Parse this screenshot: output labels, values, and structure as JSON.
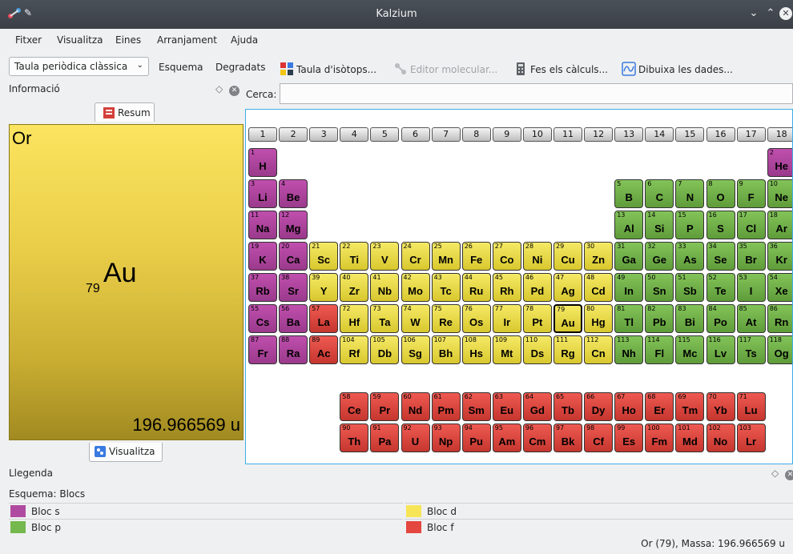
{
  "window": {
    "title": "Kalzium"
  },
  "menu": [
    "Fitxer",
    "Visualitza",
    "Eines",
    "Arranjament",
    "Ajuda"
  ],
  "toolbar": {
    "table_select": "Taula periòdica clàssica",
    "scheme": "Esquema",
    "gradients": "Degradats",
    "isotopes": "Taula d'isòtops...",
    "molecular_editor": "Editor molecular...",
    "calculator": "Fes els càlculs...",
    "plot": "Dibuixa les dades..."
  },
  "info_panel": {
    "title": "Informació",
    "tab_summary": "Resum",
    "tab_view": "Visualitza",
    "element": {
      "name": "Or",
      "symbol": "Au",
      "number": "79",
      "mass": "196.966569 u"
    }
  },
  "search": {
    "label": "Cerca:",
    "value": ""
  },
  "groups": [
    "1",
    "2",
    "3",
    "4",
    "5",
    "6",
    "7",
    "8",
    "9",
    "10",
    "11",
    "12",
    "13",
    "14",
    "15",
    "16",
    "17",
    "18"
  ],
  "elements": [
    {
      "z": "1",
      "s": "H",
      "g": 1,
      "p": 1,
      "b": "s"
    },
    {
      "z": "2",
      "s": "He",
      "g": 18,
      "p": 1,
      "b": "s"
    },
    {
      "z": "3",
      "s": "Li",
      "g": 1,
      "p": 2,
      "b": "s"
    },
    {
      "z": "4",
      "s": "Be",
      "g": 2,
      "p": 2,
      "b": "s"
    },
    {
      "z": "5",
      "s": "B",
      "g": 13,
      "p": 2,
      "b": "p"
    },
    {
      "z": "6",
      "s": "C",
      "g": 14,
      "p": 2,
      "b": "p"
    },
    {
      "z": "7",
      "s": "N",
      "g": 15,
      "p": 2,
      "b": "p"
    },
    {
      "z": "8",
      "s": "O",
      "g": 16,
      "p": 2,
      "b": "p"
    },
    {
      "z": "9",
      "s": "F",
      "g": 17,
      "p": 2,
      "b": "p"
    },
    {
      "z": "10",
      "s": "Ne",
      "g": 18,
      "p": 2,
      "b": "p"
    },
    {
      "z": "11",
      "s": "Na",
      "g": 1,
      "p": 3,
      "b": "s"
    },
    {
      "z": "12",
      "s": "Mg",
      "g": 2,
      "p": 3,
      "b": "s"
    },
    {
      "z": "13",
      "s": "Al",
      "g": 13,
      "p": 3,
      "b": "p"
    },
    {
      "z": "14",
      "s": "Si",
      "g": 14,
      "p": 3,
      "b": "p"
    },
    {
      "z": "15",
      "s": "P",
      "g": 15,
      "p": 3,
      "b": "p"
    },
    {
      "z": "16",
      "s": "S",
      "g": 16,
      "p": 3,
      "b": "p"
    },
    {
      "z": "17",
      "s": "Cl",
      "g": 17,
      "p": 3,
      "b": "p"
    },
    {
      "z": "18",
      "s": "Ar",
      "g": 18,
      "p": 3,
      "b": "p"
    },
    {
      "z": "19",
      "s": "K",
      "g": 1,
      "p": 4,
      "b": "s"
    },
    {
      "z": "20",
      "s": "Ca",
      "g": 2,
      "p": 4,
      "b": "s"
    },
    {
      "z": "21",
      "s": "Sc",
      "g": 3,
      "p": 4,
      "b": "d"
    },
    {
      "z": "22",
      "s": "Ti",
      "g": 4,
      "p": 4,
      "b": "d"
    },
    {
      "z": "23",
      "s": "V",
      "g": 5,
      "p": 4,
      "b": "d"
    },
    {
      "z": "24",
      "s": "Cr",
      "g": 6,
      "p": 4,
      "b": "d"
    },
    {
      "z": "25",
      "s": "Mn",
      "g": 7,
      "p": 4,
      "b": "d"
    },
    {
      "z": "26",
      "s": "Fe",
      "g": 8,
      "p": 4,
      "b": "d"
    },
    {
      "z": "27",
      "s": "Co",
      "g": 9,
      "p": 4,
      "b": "d"
    },
    {
      "z": "28",
      "s": "Ni",
      "g": 10,
      "p": 4,
      "b": "d"
    },
    {
      "z": "29",
      "s": "Cu",
      "g": 11,
      "p": 4,
      "b": "d"
    },
    {
      "z": "30",
      "s": "Zn",
      "g": 12,
      "p": 4,
      "b": "d"
    },
    {
      "z": "31",
      "s": "Ga",
      "g": 13,
      "p": 4,
      "b": "p"
    },
    {
      "z": "32",
      "s": "Ge",
      "g": 14,
      "p": 4,
      "b": "p"
    },
    {
      "z": "33",
      "s": "As",
      "g": 15,
      "p": 4,
      "b": "p"
    },
    {
      "z": "34",
      "s": "Se",
      "g": 16,
      "p": 4,
      "b": "p"
    },
    {
      "z": "35",
      "s": "Br",
      "g": 17,
      "p": 4,
      "b": "p"
    },
    {
      "z": "36",
      "s": "Kr",
      "g": 18,
      "p": 4,
      "b": "p"
    },
    {
      "z": "37",
      "s": "Rb",
      "g": 1,
      "p": 5,
      "b": "s"
    },
    {
      "z": "38",
      "s": "Sr",
      "g": 2,
      "p": 5,
      "b": "s"
    },
    {
      "z": "39",
      "s": "Y",
      "g": 3,
      "p": 5,
      "b": "d"
    },
    {
      "z": "40",
      "s": "Zr",
      "g": 4,
      "p": 5,
      "b": "d"
    },
    {
      "z": "41",
      "s": "Nb",
      "g": 5,
      "p": 5,
      "b": "d"
    },
    {
      "z": "42",
      "s": "Mo",
      "g": 6,
      "p": 5,
      "b": "d"
    },
    {
      "z": "43",
      "s": "Tc",
      "g": 7,
      "p": 5,
      "b": "d"
    },
    {
      "z": "44",
      "s": "Ru",
      "g": 8,
      "p": 5,
      "b": "d"
    },
    {
      "z": "45",
      "s": "Rh",
      "g": 9,
      "p": 5,
      "b": "d"
    },
    {
      "z": "46",
      "s": "Pd",
      "g": 10,
      "p": 5,
      "b": "d"
    },
    {
      "z": "47",
      "s": "Ag",
      "g": 11,
      "p": 5,
      "b": "d"
    },
    {
      "z": "48",
      "s": "Cd",
      "g": 12,
      "p": 5,
      "b": "d"
    },
    {
      "z": "49",
      "s": "In",
      "g": 13,
      "p": 5,
      "b": "p"
    },
    {
      "z": "50",
      "s": "Sn",
      "g": 14,
      "p": 5,
      "b": "p"
    },
    {
      "z": "51",
      "s": "Sb",
      "g": 15,
      "p": 5,
      "b": "p"
    },
    {
      "z": "52",
      "s": "Te",
      "g": 16,
      "p": 5,
      "b": "p"
    },
    {
      "z": "53",
      "s": "I",
      "g": 17,
      "p": 5,
      "b": "p"
    },
    {
      "z": "54",
      "s": "Xe",
      "g": 18,
      "p": 5,
      "b": "p"
    },
    {
      "z": "55",
      "s": "Cs",
      "g": 1,
      "p": 6,
      "b": "s"
    },
    {
      "z": "56",
      "s": "Ba",
      "g": 2,
      "p": 6,
      "b": "s"
    },
    {
      "z": "57",
      "s": "La",
      "g": 3,
      "p": 6,
      "b": "f"
    },
    {
      "z": "72",
      "s": "Hf",
      "g": 4,
      "p": 6,
      "b": "d"
    },
    {
      "z": "73",
      "s": "Ta",
      "g": 5,
      "p": 6,
      "b": "d"
    },
    {
      "z": "74",
      "s": "W",
      "g": 6,
      "p": 6,
      "b": "d"
    },
    {
      "z": "75",
      "s": "Re",
      "g": 7,
      "p": 6,
      "b": "d"
    },
    {
      "z": "76",
      "s": "Os",
      "g": 8,
      "p": 6,
      "b": "d"
    },
    {
      "z": "77",
      "s": "Ir",
      "g": 9,
      "p": 6,
      "b": "d"
    },
    {
      "z": "78",
      "s": "Pt",
      "g": 10,
      "p": 6,
      "b": "d"
    },
    {
      "z": "79",
      "s": "Au",
      "g": 11,
      "p": 6,
      "b": "d"
    },
    {
      "z": "80",
      "s": "Hg",
      "g": 12,
      "p": 6,
      "b": "d"
    },
    {
      "z": "81",
      "s": "Tl",
      "g": 13,
      "p": 6,
      "b": "p"
    },
    {
      "z": "82",
      "s": "Pb",
      "g": 14,
      "p": 6,
      "b": "p"
    },
    {
      "z": "83",
      "s": "Bi",
      "g": 15,
      "p": 6,
      "b": "p"
    },
    {
      "z": "84",
      "s": "Po",
      "g": 16,
      "p": 6,
      "b": "p"
    },
    {
      "z": "85",
      "s": "At",
      "g": 17,
      "p": 6,
      "b": "p"
    },
    {
      "z": "86",
      "s": "Rn",
      "g": 18,
      "p": 6,
      "b": "p"
    },
    {
      "z": "87",
      "s": "Fr",
      "g": 1,
      "p": 7,
      "b": "s"
    },
    {
      "z": "88",
      "s": "Ra",
      "g": 2,
      "p": 7,
      "b": "s"
    },
    {
      "z": "89",
      "s": "Ac",
      "g": 3,
      "p": 7,
      "b": "f"
    },
    {
      "z": "104",
      "s": "Rf",
      "g": 4,
      "p": 7,
      "b": "d"
    },
    {
      "z": "105",
      "s": "Db",
      "g": 5,
      "p": 7,
      "b": "d"
    },
    {
      "z": "106",
      "s": "Sg",
      "g": 6,
      "p": 7,
      "b": "d"
    },
    {
      "z": "107",
      "s": "Bh",
      "g": 7,
      "p": 7,
      "b": "d"
    },
    {
      "z": "108",
      "s": "Hs",
      "g": 8,
      "p": 7,
      "b": "d"
    },
    {
      "z": "109",
      "s": "Mt",
      "g": 9,
      "p": 7,
      "b": "d"
    },
    {
      "z": "110",
      "s": "Ds",
      "g": 10,
      "p": 7,
      "b": "d"
    },
    {
      "z": "111",
      "s": "Rg",
      "g": 11,
      "p": 7,
      "b": "d"
    },
    {
      "z": "112",
      "s": "Cn",
      "g": 12,
      "p": 7,
      "b": "d"
    },
    {
      "z": "113",
      "s": "Nh",
      "g": 13,
      "p": 7,
      "b": "p"
    },
    {
      "z": "114",
      "s": "Fl",
      "g": 14,
      "p": 7,
      "b": "p"
    },
    {
      "z": "115",
      "s": "Mc",
      "g": 15,
      "p": 7,
      "b": "p"
    },
    {
      "z": "116",
      "s": "Lv",
      "g": 16,
      "p": 7,
      "b": "p"
    },
    {
      "z": "117",
      "s": "Ts",
      "g": 17,
      "p": 7,
      "b": "p"
    },
    {
      "z": "118",
      "s": "Og",
      "g": 18,
      "p": 7,
      "b": "p"
    },
    {
      "z": "58",
      "s": "Ce",
      "g": 4,
      "p": 9,
      "b": "f"
    },
    {
      "z": "59",
      "s": "Pr",
      "g": 5,
      "p": 9,
      "b": "f"
    },
    {
      "z": "60",
      "s": "Nd",
      "g": 6,
      "p": 9,
      "b": "f"
    },
    {
      "z": "61",
      "s": "Pm",
      "g": 7,
      "p": 9,
      "b": "f"
    },
    {
      "z": "62",
      "s": "Sm",
      "g": 8,
      "p": 9,
      "b": "f"
    },
    {
      "z": "63",
      "s": "Eu",
      "g": 9,
      "p": 9,
      "b": "f"
    },
    {
      "z": "64",
      "s": "Gd",
      "g": 10,
      "p": 9,
      "b": "f"
    },
    {
      "z": "65",
      "s": "Tb",
      "g": 11,
      "p": 9,
      "b": "f"
    },
    {
      "z": "66",
      "s": "Dy",
      "g": 12,
      "p": 9,
      "b": "f"
    },
    {
      "z": "67",
      "s": "Ho",
      "g": 13,
      "p": 9,
      "b": "f"
    },
    {
      "z": "68",
      "s": "Er",
      "g": 14,
      "p": 9,
      "b": "f"
    },
    {
      "z": "69",
      "s": "Tm",
      "g": 15,
      "p": 9,
      "b": "f"
    },
    {
      "z": "70",
      "s": "Yb",
      "g": 16,
      "p": 9,
      "b": "f"
    },
    {
      "z": "71",
      "s": "Lu",
      "g": 17,
      "p": 9,
      "b": "f"
    },
    {
      "z": "90",
      "s": "Th",
      "g": 4,
      "p": 10,
      "b": "f"
    },
    {
      "z": "91",
      "s": "Pa",
      "g": 5,
      "p": 10,
      "b": "f"
    },
    {
      "z": "92",
      "s": "U",
      "g": 6,
      "p": 10,
      "b": "f"
    },
    {
      "z": "93",
      "s": "Np",
      "g": 7,
      "p": 10,
      "b": "f"
    },
    {
      "z": "94",
      "s": "Pu",
      "g": 8,
      "p": 10,
      "b": "f"
    },
    {
      "z": "95",
      "s": "Am",
      "g": 9,
      "p": 10,
      "b": "f"
    },
    {
      "z": "96",
      "s": "Cm",
      "g": 10,
      "p": 10,
      "b": "f"
    },
    {
      "z": "97",
      "s": "Bk",
      "g": 11,
      "p": 10,
      "b": "f"
    },
    {
      "z": "98",
      "s": "Cf",
      "g": 12,
      "p": 10,
      "b": "f"
    },
    {
      "z": "99",
      "s": "Es",
      "g": 13,
      "p": 10,
      "b": "f"
    },
    {
      "z": "100",
      "s": "Fm",
      "g": 14,
      "p": 10,
      "b": "f"
    },
    {
      "z": "101",
      "s": "Md",
      "g": 15,
      "p": 10,
      "b": "f"
    },
    {
      "z": "102",
      "s": "No",
      "g": 16,
      "p": 10,
      "b": "f"
    },
    {
      "z": "103",
      "s": "Lr",
      "g": 17,
      "p": 10,
      "b": "f"
    }
  ],
  "legend": {
    "title": "Llegenda",
    "scheme": "Esquema: Blocs",
    "items": [
      {
        "label": "Bloc s",
        "color": "#b04aa0"
      },
      {
        "label": "Bloc d",
        "color": "#f7e558"
      },
      {
        "label": "Bloc p",
        "color": "#74b84e"
      },
      {
        "label": "Bloc f",
        "color": "#e3473f"
      }
    ]
  },
  "status": "Or (79), Massa: 196.966569 u"
}
